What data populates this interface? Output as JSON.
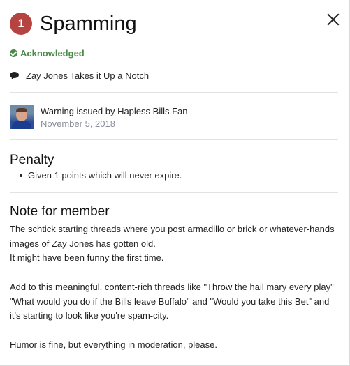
{
  "header": {
    "badge_count": "1",
    "title": "Spamming"
  },
  "status": {
    "label": "Acknowledged",
    "color": "#4a8a4a"
  },
  "topic": {
    "icon": "comment-icon",
    "title": "Zay Jones Takes it Up a Notch"
  },
  "warning": {
    "issued_by": "Warning issued by Hapless Bills Fan",
    "date": "November 5, 2018"
  },
  "penalty": {
    "heading": "Penalty",
    "items": [
      "Given 1 points which will never expire."
    ]
  },
  "note": {
    "heading": "Note for member",
    "lines": [
      "The schtick starting threads where you post armadillo or brick or whatever-hands",
      "images of Zay Jones has gotten old.",
      "It might have been funny the first time.",
      "",
      "Add to this meaningful, content-rich threads like \"Throw the hail mary every play\"",
      "\"What would you do if the Bills leave Buffalo\" and \"Would you take this Bet\" and",
      "it's starting to look like you're spam-city.",
      "",
      "Humor is fine, but everything in moderation, please."
    ]
  },
  "colors": {
    "badge": "#b5433f",
    "muted_text": "#8a8f99"
  }
}
